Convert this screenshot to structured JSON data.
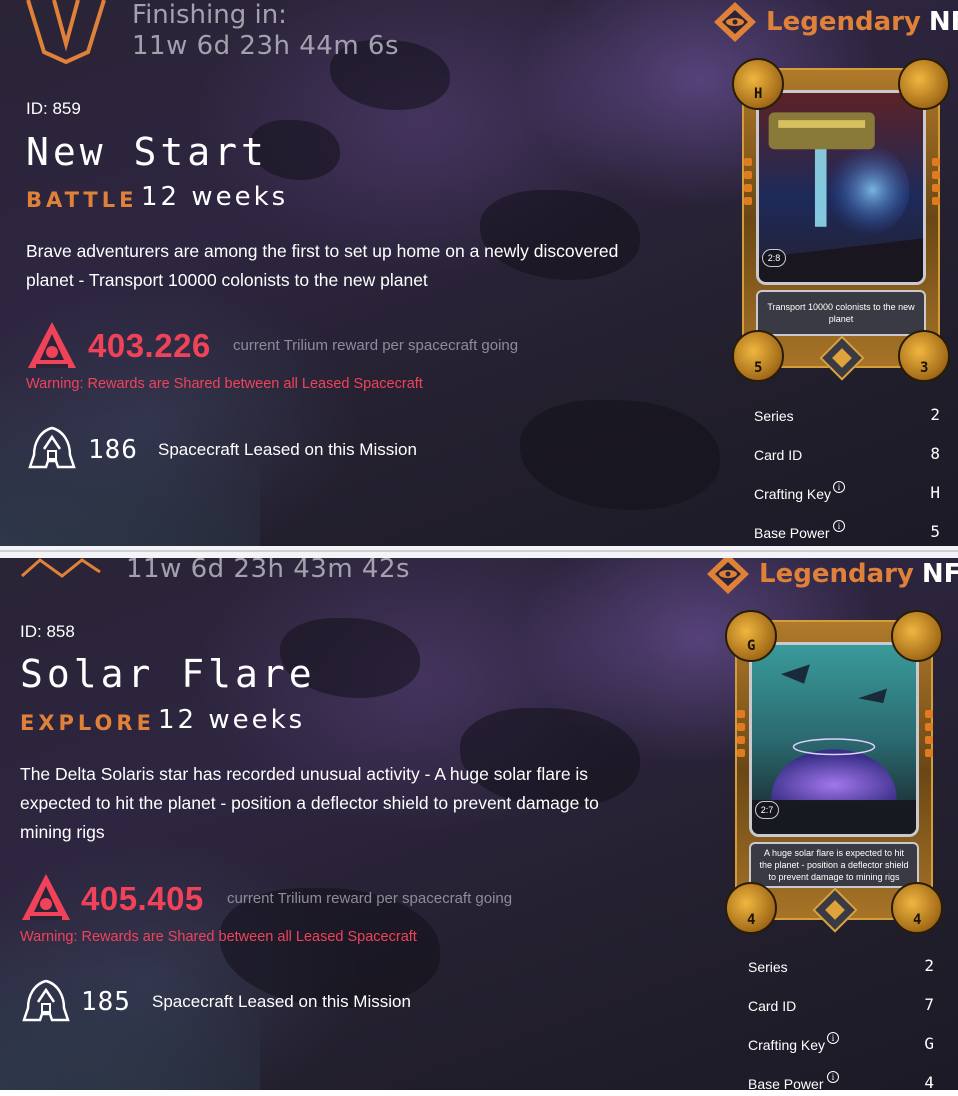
{
  "brand": {
    "word_a": "Legendary",
    "word_b": "NFTs"
  },
  "missions": [
    {
      "timer_label": "Finishing in:",
      "timer_value": "11w 6d 23h 44m 6s",
      "id_text": "ID: 859",
      "title": "New Start",
      "type": "BATTLE",
      "duration": "12 weeks",
      "description_lines": [
        "Brave adventurers are among the first to set up home on a newly discovered",
        "planet - Transport 10000 colonists to the new planet"
      ],
      "reward_value": "403.226",
      "reward_caption": "current Trilium reward per spacecraft going",
      "warning": "Warning: Rewards are Shared between all Leased Spacecraft",
      "leased_count": "186",
      "leased_caption": "Spacecraft Leased on this Mission",
      "card": {
        "crafting_key": "H",
        "ratio": "2:8",
        "caption": "Transport 10000 colonists to the new planet",
        "bottom_left": "5",
        "bottom_right": "3"
      },
      "specs": [
        {
          "label": "Series",
          "value": "2",
          "info": false
        },
        {
          "label": "Card ID",
          "value": "8",
          "info": false
        },
        {
          "label": "Crafting Key",
          "value": "H",
          "info": true
        },
        {
          "label": "Base Power",
          "value": "5",
          "info": true
        }
      ]
    },
    {
      "timer_value": "11w 6d 23h 43m 42s",
      "id_text": "ID: 858",
      "title": "Solar Flare",
      "type": "EXPLORE",
      "duration": "12 weeks",
      "description_lines": [
        "The Delta Solaris star has recorded unusual activity - A huge solar flare is",
        "expected to hit the planet - position a deflector shield to prevent damage to",
        "mining rigs"
      ],
      "reward_value": "405.405",
      "reward_caption": "current Trilium reward per spacecraft going",
      "warning": "Warning: Rewards are Shared between all Leased Spacecraft",
      "leased_count": "185",
      "leased_caption": "Spacecraft Leased on this Mission",
      "card": {
        "crafting_key": "G",
        "ratio": "2:7",
        "caption": "A huge solar flare is expected to hit the planet - position a deflector shield to prevent damage to mining rigs",
        "bottom_left": "4",
        "bottom_right": "4"
      },
      "specs": [
        {
          "label": "Series",
          "value": "2",
          "info": false
        },
        {
          "label": "Card ID",
          "value": "7",
          "info": false
        },
        {
          "label": "Crafting Key",
          "value": "G",
          "info": true
        },
        {
          "label": "Base Power",
          "value": "4",
          "info": true
        }
      ]
    }
  ],
  "icons": {
    "emblem": "chevron-emblem-icon",
    "brand": "diamond-eye-logo-icon",
    "reward": "trilium-reward-icon",
    "ship": "spacecraft-icon",
    "info": "info-icon"
  },
  "colors": {
    "accent_orange": "#e0813a",
    "reward_red": "#f0435a",
    "muted_text": "#a4a1ae"
  }
}
